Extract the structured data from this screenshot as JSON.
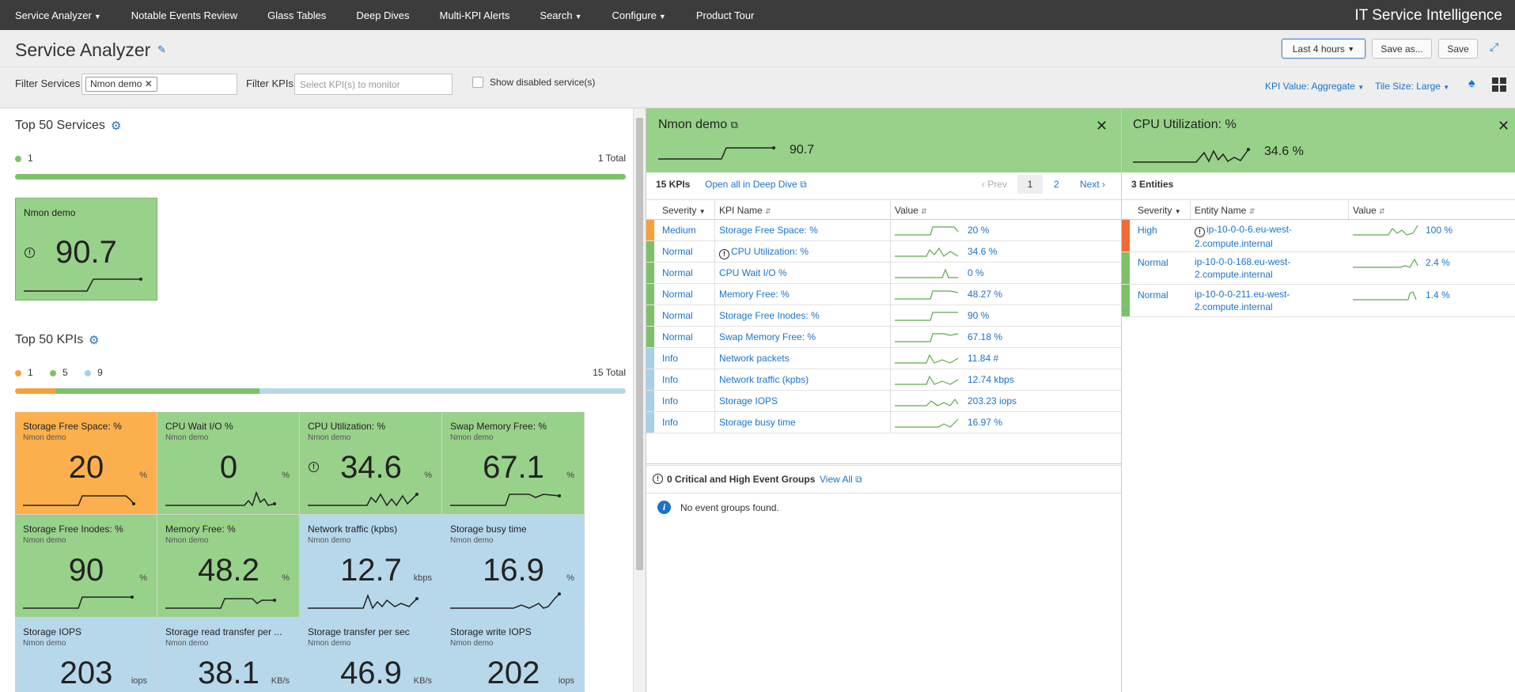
{
  "nav": {
    "items": [
      "Service Analyzer",
      "Notable Events Review",
      "Glass Tables",
      "Deep Dives",
      "Multi-KPI Alerts",
      "Search",
      "Configure",
      "Product Tour"
    ],
    "brand": "IT Service Intelligence"
  },
  "header": {
    "title": "Service Analyzer",
    "time_range": "Last 4 hours",
    "save_as": "Save as...",
    "save": "Save"
  },
  "filters": {
    "filter_services_label": "Filter Services",
    "service_pill": "Nmon demo",
    "filter_kpis_label": "Filter KPIs",
    "kpi_placeholder": "Select KPI(s) to monitor",
    "show_disabled_label": "Show disabled service(s)",
    "kpi_value": "KPI Value: Aggregate",
    "tile_size": "Tile Size: Large"
  },
  "services": {
    "title": "Top 50 Services",
    "legend_count": "1",
    "total": "1 Total",
    "tile": {
      "name": "Nmon demo",
      "value": "90.7"
    }
  },
  "kpis": {
    "title": "Top 50 KPIs",
    "legend": [
      {
        "count": "1",
        "color": "#f7a03a"
      },
      {
        "count": "5",
        "color": "#7cc16a"
      },
      {
        "count": "9",
        "color": "#a8cfe8"
      }
    ],
    "total": "15 Total",
    "tiles": [
      {
        "name": "Storage Free Space: %",
        "service": "Nmon demo",
        "value": "20",
        "unit": "%",
        "color": "orange"
      },
      {
        "name": "CPU Wait I/O %",
        "service": "Nmon demo",
        "value": "0",
        "unit": "%",
        "color": "green"
      },
      {
        "name": "CPU Utilization: %",
        "service": "Nmon demo",
        "value": "34.6",
        "unit": "%",
        "color": "green"
      },
      {
        "name": "Swap Memory Free: %",
        "service": "Nmon demo",
        "value": "67.1",
        "unit": "%",
        "color": "green"
      },
      {
        "name": "Storage Free Inodes: %",
        "service": "Nmon demo",
        "value": "90",
        "unit": "%",
        "color": "green"
      },
      {
        "name": "Memory Free: %",
        "service": "Nmon demo",
        "value": "48.2",
        "unit": "%",
        "color": "green"
      },
      {
        "name": "Network traffic (kpbs)",
        "service": "Nmon demo",
        "value": "12.7",
        "unit": "kbps",
        "color": "blue"
      },
      {
        "name": "Storage busy time",
        "service": "Nmon demo",
        "value": "16.9",
        "unit": "%",
        "color": "blue"
      },
      {
        "name": "Storage IOPS",
        "service": "Nmon demo",
        "value": "203",
        "unit": "iops",
        "color": "blue"
      },
      {
        "name": "Storage read transfer per ...",
        "service": "Nmon demo",
        "value": "38.1",
        "unit": "KB/s",
        "color": "blue"
      },
      {
        "name": "Storage transfer per sec",
        "service": "Nmon demo",
        "value": "46.9",
        "unit": "KB/s",
        "color": "blue"
      },
      {
        "name": "Storage write IOPS",
        "service": "Nmon demo",
        "value": "202",
        "unit": "iops",
        "color": "blue"
      }
    ]
  },
  "service_panel": {
    "title": "Nmon demo",
    "value": "90.7",
    "kpi_count": "15 KPIs",
    "open_all": "Open all in Deep Dive",
    "prev": "Prev",
    "page1": "1",
    "page2": "2",
    "next": "Next",
    "columns": [
      "Severity",
      "KPI Name",
      "Value"
    ],
    "rows": [
      {
        "severity": "Medium",
        "kpi": "Storage Free Space: %",
        "value": "20 %",
        "color": "#f7a03a"
      },
      {
        "severity": "Normal",
        "kpi": "CPU Utilization: %",
        "value": "34.6 %",
        "color": "#7cc16a",
        "warn": true
      },
      {
        "severity": "Normal",
        "kpi": "CPU Wait I/O %",
        "value": "0 %",
        "color": "#7cc16a"
      },
      {
        "severity": "Normal",
        "kpi": "Memory Free: %",
        "value": "48.27 %",
        "color": "#7cc16a"
      },
      {
        "severity": "Normal",
        "kpi": "Storage Free Inodes: %",
        "value": "90 %",
        "color": "#7cc16a"
      },
      {
        "severity": "Normal",
        "kpi": "Swap Memory Free: %",
        "value": "67.18 %",
        "color": "#7cc16a"
      },
      {
        "severity": "Info",
        "kpi": "Network packets",
        "value": "11.84 #",
        "color": "#a8cfe8"
      },
      {
        "severity": "Info",
        "kpi": "Network traffic (kpbs)",
        "value": "12.74 kbps",
        "color": "#a8cfe8"
      },
      {
        "severity": "Info",
        "kpi": "Storage IOPS",
        "value": "203.23 iops",
        "color": "#a8cfe8"
      },
      {
        "severity": "Info",
        "kpi": "Storage busy time",
        "value": "16.97 %",
        "color": "#a8cfe8"
      }
    ],
    "events_title": "0 Critical and High Event Groups",
    "view_all": "View All",
    "no_events": "No event groups found."
  },
  "kpi_panel": {
    "title": "CPU Utilization: %",
    "value": "34.6 %",
    "entity_count": "3 Entities",
    "columns": [
      "Severity",
      "Entity Name",
      "Value"
    ],
    "rows": [
      {
        "severity": "High",
        "entity_line1": "ip-10-0-0-6.eu-west-",
        "entity_line2": "2.compute.internal",
        "value": "100 %",
        "color": "#f26a35",
        "warn": true
      },
      {
        "severity": "Normal",
        "entity_line1": "ip-10-0-0-168.eu-west-",
        "entity_line2": "2.compute.internal",
        "value": "2.4 %",
        "color": "#7cc16a"
      },
      {
        "severity": "Normal",
        "entity_line1": "ip-10-0-0-211.eu-west-",
        "entity_line2": "2.compute.internal",
        "value": "1.4 %",
        "color": "#7cc16a"
      }
    ]
  }
}
